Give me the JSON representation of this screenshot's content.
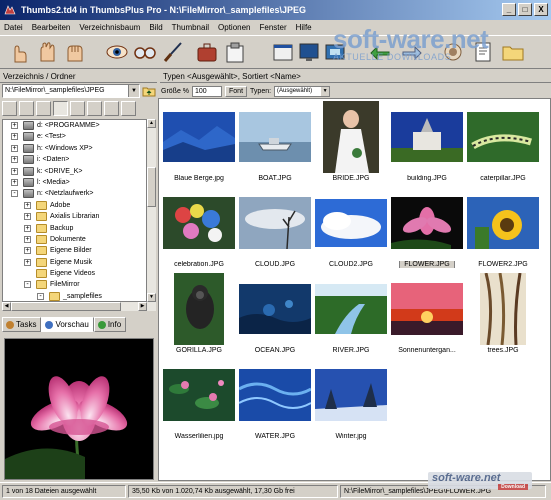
{
  "window": {
    "title": "Thumbs2.td4 in ThumbsPlus Pro - N:\\FileMirror\\_samplefiles\\JPEG",
    "minimize": "_",
    "maximize": "□",
    "close": "X"
  },
  "menu": [
    "Datei",
    "Bearbeiten",
    "Verzeichnisbaum",
    "Bild",
    "Thumbnail",
    "Optionen",
    "Fenster",
    "Hilfe"
  ],
  "watermark": {
    "brand": "soft-ware.net",
    "sub": "AKTUELLE DOWNLOADS"
  },
  "left_pane": {
    "header": "Verzeichnis / Ordner",
    "path": "N:\\FileMirror\\_samplefiles\\JPEG",
    "tree": [
      {
        "indent": 0,
        "expander": "+",
        "icon": "drive",
        "label": "d: <PROGRAMME>"
      },
      {
        "indent": 0,
        "expander": "+",
        "icon": "drive",
        "label": "e: <Test>"
      },
      {
        "indent": 0,
        "expander": "+",
        "icon": "drive",
        "label": "h: <Windows XP>"
      },
      {
        "indent": 0,
        "expander": "+",
        "icon": "drive",
        "label": "i: <Daten>"
      },
      {
        "indent": 0,
        "expander": "+",
        "icon": "drive",
        "label": "k: <DRIVE_K>"
      },
      {
        "indent": 0,
        "expander": "+",
        "icon": "drive",
        "label": "l: <Media>"
      },
      {
        "indent": 0,
        "expander": "-",
        "icon": "drive",
        "label": "n: <Netzlaufwerk>"
      },
      {
        "indent": 1,
        "expander": "+",
        "icon": "folder",
        "label": "Adobe"
      },
      {
        "indent": 1,
        "expander": "+",
        "icon": "folder",
        "label": "Axialis Librarian"
      },
      {
        "indent": 1,
        "expander": "+",
        "icon": "folder",
        "label": "Backup"
      },
      {
        "indent": 1,
        "expander": "+",
        "icon": "folder",
        "label": "Dokumente"
      },
      {
        "indent": 1,
        "expander": "+",
        "icon": "folder",
        "label": "Eigene Bilder"
      },
      {
        "indent": 1,
        "expander": "+",
        "icon": "folder",
        "label": "Eigene Musik"
      },
      {
        "indent": 1,
        "expander": "",
        "icon": "folder",
        "label": "Eigene Videos"
      },
      {
        "indent": 1,
        "expander": "-",
        "icon": "folder",
        "label": "FileMirror"
      },
      {
        "indent": 2,
        "expander": "-",
        "icon": "folder",
        "label": "_samplefiles"
      }
    ],
    "tabs": [
      {
        "label": "Tasks",
        "active": false,
        "color": "#c08030"
      },
      {
        "label": "Vorschau",
        "active": true,
        "color": "#4070c0"
      },
      {
        "label": "Info",
        "active": false,
        "color": "#3a9a3a"
      }
    ]
  },
  "right_pane": {
    "header": "Typen <Ausgewählt>, Sortiert <Name>",
    "size_label": "Größe %",
    "size_value": "100",
    "font_button": "Font",
    "types_label": "Typen:",
    "types_value": "(Ausgewählt)"
  },
  "thumbnails": [
    {
      "name": "Blaue Berge.jpg",
      "scene": "mountains",
      "selected": false
    },
    {
      "name": "BOAT.JPG",
      "scene": "boat",
      "selected": false
    },
    {
      "name": "BRIDE.JPG",
      "scene": "bride",
      "selected": false
    },
    {
      "name": "building.JPG",
      "scene": "church",
      "selected": false
    },
    {
      "name": "caterpillar.JPG",
      "scene": "caterpillar",
      "selected": false
    },
    {
      "name": "celebration.JPG",
      "scene": "celebration",
      "selected": false
    },
    {
      "name": "CLOUD.JPG",
      "scene": "cloud",
      "selected": false
    },
    {
      "name": "CLOUD2.JPG",
      "scene": "cloud2",
      "selected": false
    },
    {
      "name": "FLOWER.JPG",
      "scene": "flower",
      "selected": true
    },
    {
      "name": "FLOWER2.JPG",
      "scene": "sunflower",
      "selected": false
    },
    {
      "name": "GORILLA.JPG",
      "scene": "gorilla",
      "selected": false
    },
    {
      "name": "OCEAN.JPG",
      "scene": "ocean",
      "selected": false
    },
    {
      "name": "RIVER.JPG",
      "scene": "river",
      "selected": false
    },
    {
      "name": "Sonnenuntergan...",
      "scene": "sunset",
      "selected": false
    },
    {
      "name": "trees.JPG",
      "scene": "trees",
      "selected": false
    },
    {
      "name": "Wasserlilien.jpg",
      "scene": "lilies",
      "selected": false
    },
    {
      "name": "WATER.JPG",
      "scene": "water",
      "selected": false
    },
    {
      "name": "Winter.jpg",
      "scene": "winter",
      "selected": false
    }
  ],
  "status": {
    "selection": "1 von 18 Dateien ausgewählt",
    "sizes": "35,50 Kb von 1.020,74 Kb ausgewählt, 17,30 Gb frei",
    "path": "N:\\FileMirror\\_samplefiles\\JPEG\\FLOWER.JPG"
  },
  "badge": {
    "brand": "soft-ware.net",
    "sub": "Download"
  }
}
